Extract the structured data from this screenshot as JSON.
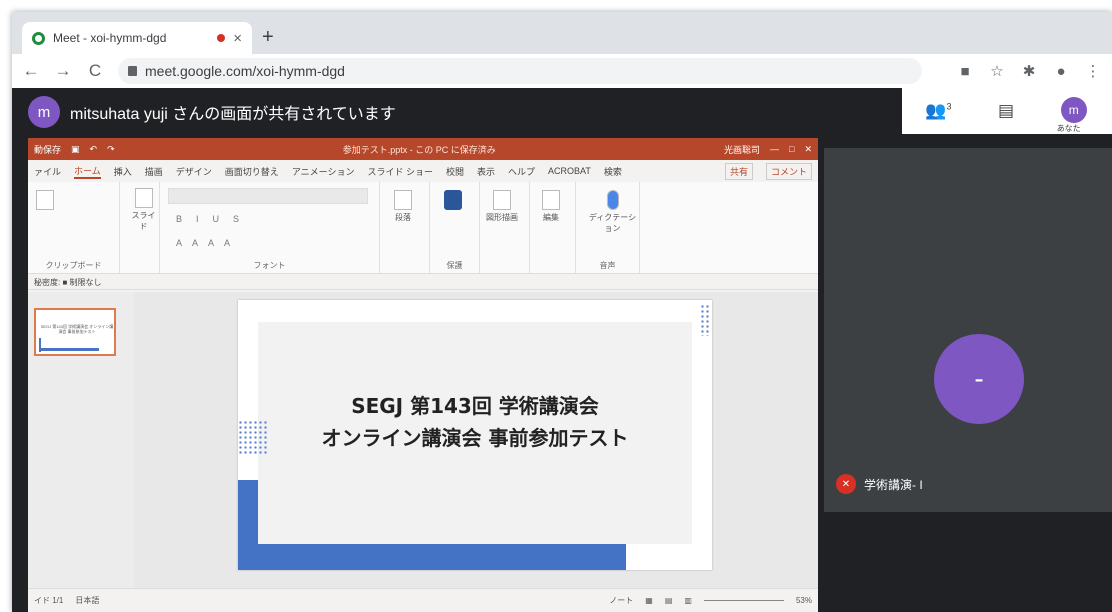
{
  "browser": {
    "tab_title": "Meet - xoi-hymm-dgd",
    "tab_close": "×",
    "new_tab": "+",
    "back": "←",
    "forward": "→",
    "reload": "C",
    "url": "meet.google.com/xoi-hymm-dgd",
    "icons": [
      "camera-icon",
      "star-icon",
      "extensions-icon",
      "profile-icon",
      "menu-icon"
    ]
  },
  "meet": {
    "presenter_initial": "m",
    "presenter_text": "mitsuhata yuji さんの画面が共有されています",
    "participant_count": "3",
    "self_initial": "m",
    "self_label": "あなた",
    "participant_initial": "-",
    "participant_name": "学術講演- I"
  },
  "ppt": {
    "autosave": "動保存",
    "doc_title": "参加テスト.pptx - この PC に保存済み",
    "user": "光画聡司",
    "menu": [
      "ァイル",
      "ホーム",
      "挿入",
      "描画",
      "デザイン",
      "画面切り替え",
      "アニメーション",
      "スライド ショー",
      "校閲",
      "表示",
      "ヘルプ",
      "ACROBAT",
      "検索"
    ],
    "active_menu": "ホーム",
    "share": "共有",
    "comment": "コメント",
    "groups": [
      "クリップボード",
      "フォント",
      "段落",
      "保護",
      "図形描画",
      "編集",
      "音声"
    ],
    "slide_btn": "スライド",
    "dictation": "ディクテーション",
    "statusline": "秘密度: ■ 制限なし",
    "slide_line1": "SEGJ 第143回 学術講演会",
    "slide_line2": "オンライン講演会 事前参加テスト",
    "thumb_text": "SEGJ 第143回 学術講演会 オンライン講演会 事前参加テスト",
    "status_page": "イド 1/1",
    "status_lang": "日本語",
    "status_notes": "ノート",
    "zoom": "53%"
  }
}
